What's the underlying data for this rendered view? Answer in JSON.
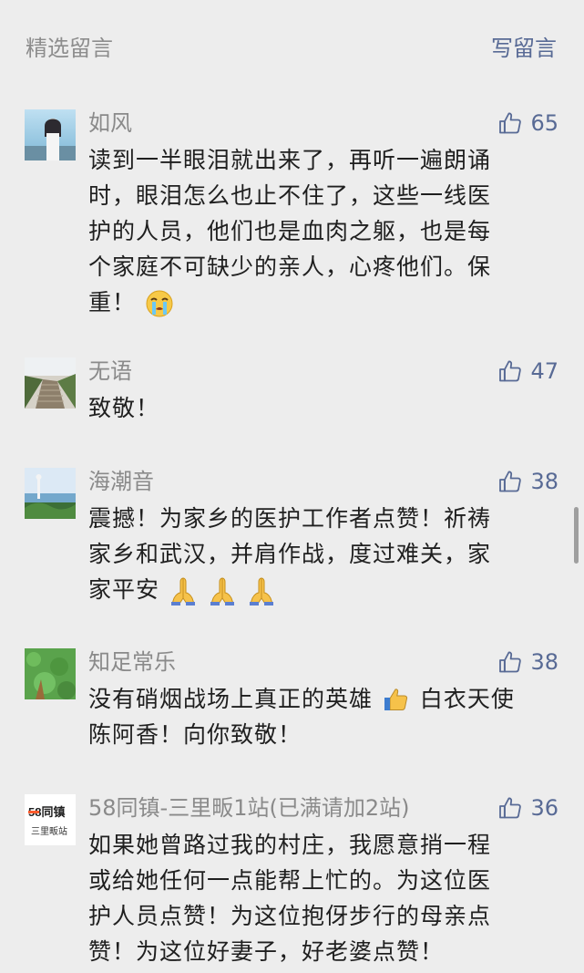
{
  "header": {
    "title": "精选留言",
    "action": "写留言"
  },
  "comments": [
    {
      "author": "如风",
      "likes": "65",
      "line1": "读到一半眼泪就出来了，再听一遍朗诵",
      "line2": "时，眼泪怎么也止不住了，这些一线医",
      "line3": "护的人员，他们也是血肉之躯，也是每",
      "line4": "个家庭不可缺少的亲人，心疼他们。保",
      "line5": "重！"
    },
    {
      "author": "无语",
      "likes": "47",
      "line1": "致敬！"
    },
    {
      "author": "海潮音",
      "likes": "38",
      "line1": "震撼！为家乡的医护工作者点赞！祈祷",
      "line2": "家乡和武汉，并肩作战，度过难关，家",
      "line3": "家平安"
    },
    {
      "author": "知足常乐",
      "likes": "38",
      "line1a": "没有硝烟战场上真正的英雄",
      "line1b": "白衣天使",
      "line2": "陈阿香！向你致敬！"
    },
    {
      "author": "58同镇-三里畈1站(已满请加2站)",
      "likes": "36",
      "avatar_text_top": "58同镇",
      "avatar_text_bottom": "三里畈站",
      "line1": "如果她曾路过我的村庄，我愿意捎一程",
      "line2": "或给她任何一点能帮上忙的。为这位医",
      "line3": "护人员点赞！为这位抱伢步行的母亲点",
      "line4": "赞！为这位好妻子，好老婆点赞！"
    }
  ],
  "colors": {
    "background": "#ededed",
    "link": "#586a95",
    "meta": "#8a8a8a",
    "text": "#1f1f1f"
  },
  "icons": {
    "like": "thumbs-up-outline-icon",
    "crying": "crying-face-emoji",
    "pray": "folded-hands-emoji",
    "thumbs_up": "thumbs-up-emoji"
  }
}
